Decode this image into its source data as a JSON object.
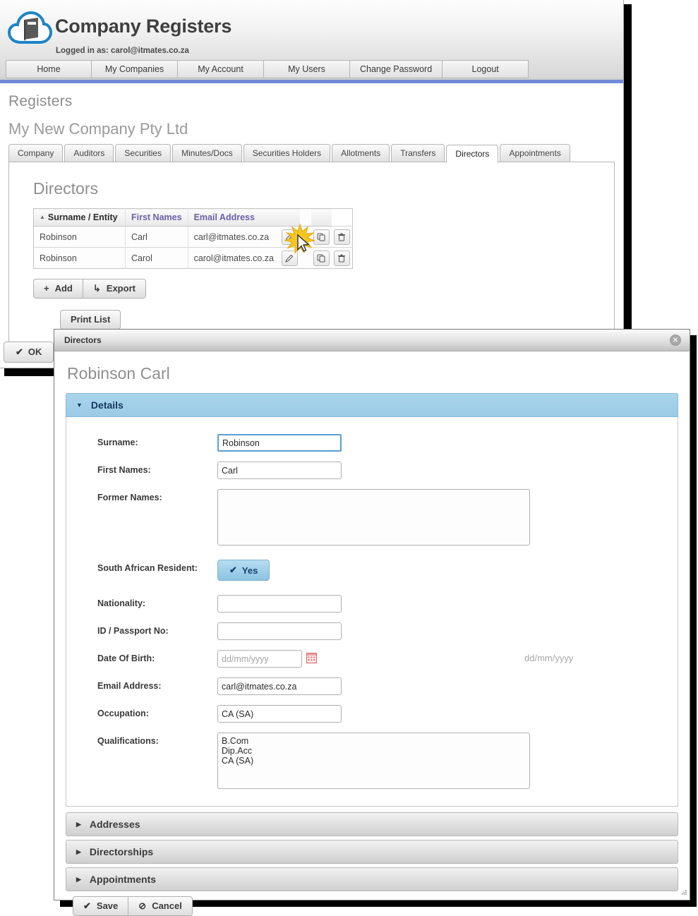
{
  "app": {
    "title": "Company Registers",
    "logged_in_as": "Logged in as: carol@itmates.co.za",
    "logo_icon": "cloud-book-icon",
    "accent_color": "#7189d6"
  },
  "nav": {
    "items": [
      {
        "label": "Home"
      },
      {
        "label": "My Companies"
      },
      {
        "label": "My Account"
      },
      {
        "label": "My Users"
      },
      {
        "label": "Change Password"
      },
      {
        "label": "Logout"
      }
    ]
  },
  "registers": {
    "heading": "Registers",
    "company_name": "My New Company Pty Ltd",
    "tabs": [
      {
        "label": "Company",
        "active": false
      },
      {
        "label": "Auditors",
        "active": false
      },
      {
        "label": "Securities",
        "active": false
      },
      {
        "label": "Minutes/Docs",
        "active": false
      },
      {
        "label": "Securities Holders",
        "active": false
      },
      {
        "label": "Allotments",
        "active": false
      },
      {
        "label": "Transfers",
        "active": false
      },
      {
        "label": "Directors",
        "active": true
      },
      {
        "label": "Appointments",
        "active": false
      }
    ],
    "panel_title": "Directors",
    "table": {
      "sort_caret": "▲",
      "columns": [
        {
          "label": "Surname / Entity",
          "sorted": true
        },
        {
          "label": "First Names",
          "sorted": false
        },
        {
          "label": "Email Address",
          "sorted": false
        }
      ],
      "rows": [
        {
          "surname": "Robinson",
          "first_names": "Carl",
          "email": "carl@itmates.co.za"
        },
        {
          "surname": "Robinson",
          "first_names": "Carol",
          "email": "carol@itmates.co.za"
        }
      ],
      "row_actions": [
        {
          "name": "edit-icon",
          "title": "Edit"
        },
        {
          "name": "copy-icon",
          "title": "Copy"
        },
        {
          "name": "delete-icon",
          "title": "Delete"
        }
      ]
    },
    "buttons": {
      "add": {
        "label": "Add",
        "icon": "plus-icon",
        "glyph": "+"
      },
      "export": {
        "label": "Export",
        "icon": "export-arrow-icon",
        "glyph": "↳"
      },
      "print_list": {
        "label": "Print List"
      },
      "ok": {
        "label": "OK",
        "icon": "check-icon",
        "glyph": "✔"
      }
    }
  },
  "dialog": {
    "titlebar": "Directors",
    "close_glyph": "✕",
    "person_name": "Robinson Carl",
    "sections": [
      {
        "label": "Details",
        "open": true,
        "caret": "▼"
      },
      {
        "label": "Addresses",
        "open": false,
        "caret": "▶"
      },
      {
        "label": "Directorships",
        "open": false,
        "caret": "▶"
      },
      {
        "label": "Appointments",
        "open": false,
        "caret": "▶"
      }
    ],
    "fields": {
      "surname": {
        "label": "Surname:",
        "value": "Robinson",
        "placeholder": ""
      },
      "first_names": {
        "label": "First Names:",
        "value": "Carl",
        "placeholder": ""
      },
      "former_names": {
        "label": "Former Names:",
        "value": "",
        "placeholder": ""
      },
      "sa_resident": {
        "label": "South African Resident:",
        "value": "Yes",
        "glyph": "✔"
      },
      "nationality": {
        "label": "Nationality:",
        "value": "",
        "placeholder": ""
      },
      "id_passport": {
        "label": "ID / Passport No:",
        "value": "",
        "placeholder": ""
      },
      "date_of_birth": {
        "label": "Date Of Birth:",
        "value": "",
        "placeholder": "dd/mm/yyyy",
        "hint": "dd/mm/yyyy",
        "icon": "calendar-icon"
      },
      "email_address": {
        "label": "Email Address:",
        "value": "carl@itmates.co.za",
        "placeholder": ""
      },
      "occupation": {
        "label": "Occupation:",
        "value": "CA (SA)",
        "placeholder": ""
      },
      "qualifications": {
        "label": "Qualifications:",
        "value": "B.Com\nDip.Acc\nCA (SA)",
        "placeholder": ""
      }
    },
    "buttons": {
      "save": {
        "label": "Save",
        "glyph": "✔"
      },
      "cancel": {
        "label": "Cancel",
        "glyph": "⊘"
      }
    }
  }
}
